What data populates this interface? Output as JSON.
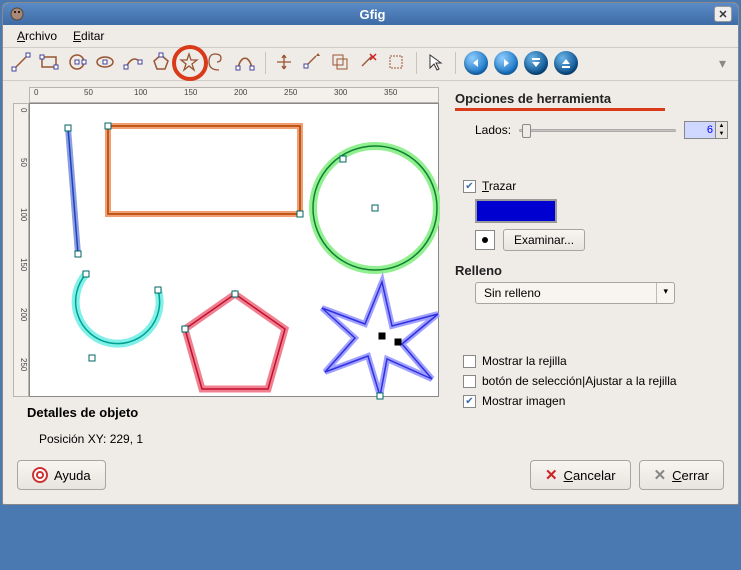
{
  "window": {
    "title": "Gfig"
  },
  "menu": {
    "file": "Archivo",
    "edit": "Editar"
  },
  "toolbar": {
    "icons": [
      "line",
      "rect",
      "circle",
      "ellipse",
      "arc",
      "polygon",
      "star",
      "spiral",
      "bezier",
      "move-obj",
      "move-point",
      "copy",
      "delete",
      "select-obj",
      "cursor"
    ],
    "nav": [
      "prev",
      "next",
      "top",
      "bottom"
    ]
  },
  "side": {
    "options_title": "Opciones de herramienta",
    "sides_label": "Lados:",
    "sides_value": "6",
    "trace_label": "Trazar",
    "trace_checked": true,
    "examine_label": "Examinar...",
    "fill_title": "Relleno",
    "fill_value": "Sin relleno",
    "show_grid": "Mostrar la rejilla",
    "show_grid_checked": false,
    "snap_grid": "botón de selección|Ajustar a la rejilla",
    "snap_grid_checked": false,
    "show_image": "Mostrar imagen",
    "show_image_checked": true
  },
  "details": {
    "title": "Detalles de objeto",
    "pos_label": "Posición XY:  229, 1"
  },
  "footer": {
    "help": "Ayuda",
    "cancel": "Cancelar",
    "close": "Cerrar"
  },
  "ruler_h": [
    "0",
    "50",
    "100",
    "150",
    "200",
    "250",
    "300",
    "350"
  ],
  "ruler_v": [
    "0",
    "50",
    "100",
    "150",
    "200",
    "250"
  ]
}
